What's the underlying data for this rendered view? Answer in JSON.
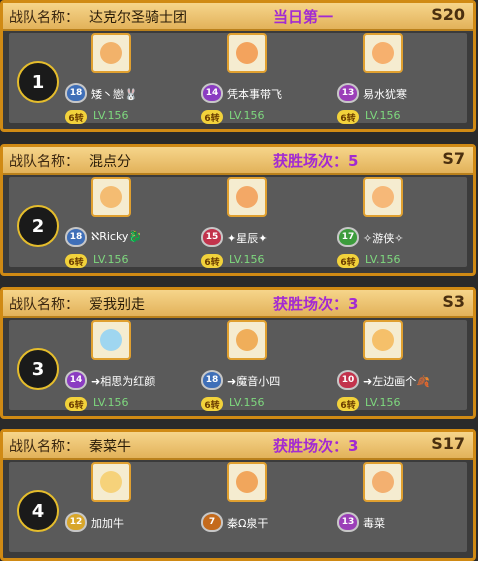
{
  "labels": {
    "team": "战队名称：",
    "lv_prefix": "LV."
  },
  "teams": [
    {
      "rank": "1",
      "name": "达克尔圣骑士团",
      "status": "当日第一",
      "season": "S20",
      "members": [
        {
          "name": "矮丶戀🐰",
          "badge": "18",
          "badge_color": "#3f6fb8",
          "zhuan": "6转",
          "level": "156",
          "face": "#f2b26a"
        },
        {
          "name": "凭本事带飞",
          "badge": "14",
          "badge_color": "#8b3cc2",
          "zhuan": "6转",
          "level": "156",
          "face": "#f3a35d"
        },
        {
          "name": "易水犹寒",
          "badge": "13",
          "badge_color": "#9b3fb8",
          "zhuan": "6转",
          "level": "156",
          "face": "#f6b06e"
        }
      ]
    },
    {
      "rank": "2",
      "name": "混点分",
      "status": "获胜场次：5",
      "season": "S7",
      "members": [
        {
          "name": "ℵRicky🐉",
          "badge": "18",
          "badge_color": "#3f6fb8",
          "zhuan": "6转",
          "level": "156",
          "face": "#f4bc72"
        },
        {
          "name": "✦星辰✦",
          "badge": "15",
          "badge_color": "#c2334c",
          "zhuan": "6转",
          "level": "156",
          "face": "#f3a866"
        },
        {
          "name": "✧游侠✧",
          "badge": "17",
          "badge_color": "#3c9c3c",
          "zhuan": "6转",
          "level": "156",
          "face": "#f6b878"
        }
      ]
    },
    {
      "rank": "3",
      "name": "爱我别走",
      "status": "获胜场次：3",
      "season": "S3",
      "members": [
        {
          "name": "➜相思为红颜",
          "badge": "14",
          "badge_color": "#8b3cc2",
          "zhuan": "6转",
          "level": "156",
          "face": "#9fd6f0"
        },
        {
          "name": "➜魔音小四",
          "badge": "18",
          "badge_color": "#3f6fb8",
          "zhuan": "6转",
          "level": "156",
          "face": "#f0ae5a"
        },
        {
          "name": "➜左边画个🍂",
          "badge": "10",
          "badge_color": "#c2334c",
          "zhuan": "6转",
          "level": "156",
          "face": "#f5c06a"
        }
      ]
    },
    {
      "rank": "4",
      "name": "秦菜牛",
      "status": "获胜场次：3",
      "season": "S17",
      "members": [
        {
          "name": "加加牛",
          "badge": "12",
          "badge_color": "#d8a62a",
          "zhuan": "",
          "level": "",
          "face": "#f6d27a"
        },
        {
          "name": "秦Ω泉干",
          "badge": "7",
          "badge_color": "#c46a1c",
          "zhuan": "",
          "level": "",
          "face": "#f1a65c"
        },
        {
          "name": "毒菜",
          "badge": "13",
          "badge_color": "#9b3fb8",
          "zhuan": "",
          "level": "",
          "face": "#f3b070"
        }
      ]
    }
  ]
}
